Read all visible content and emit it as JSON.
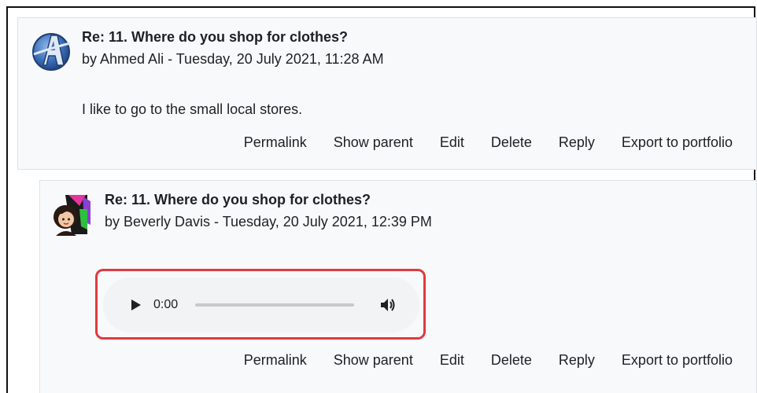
{
  "posts": [
    {
      "subject": "Re: 11. Where do you shop for clothes?",
      "byline": "by Ahmed Ali - Tuesday, 20 July 2021, 11:28 AM",
      "content": "I like to go to the small local stores.",
      "commands": [
        "Permalink",
        "Show parent",
        "Edit",
        "Delete",
        "Reply",
        "Export to portfolio"
      ]
    },
    {
      "subject": "Re: 11. Where do you shop for clothes?",
      "byline": "by Beverly Davis - Tuesday, 20 July 2021, 12:39 PM",
      "audio": {
        "time": "0:00",
        "progress": 0
      },
      "commands": [
        "Permalink",
        "Show parent",
        "Edit",
        "Delete",
        "Reply",
        "Export to portfolio"
      ]
    }
  ],
  "colors": {
    "highlight": "#e03a3e",
    "post_bg": "#f8f9fa",
    "player_bg": "#f1f3f4"
  },
  "icons": [
    "avengers-avatar-icon",
    "woman-avatar-icon",
    "play-icon",
    "volume-icon"
  ]
}
